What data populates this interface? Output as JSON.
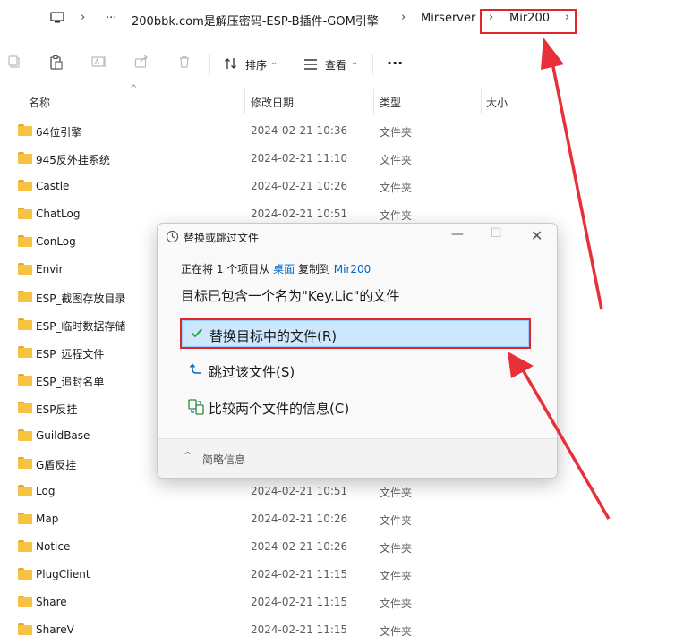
{
  "address": {
    "crumbs": [
      "200bbk.com是解压密码-ESP-B插件-GOM引擎",
      "Mirserver",
      "Mir200"
    ],
    "more": "···"
  },
  "toolbar": {
    "sort_label": "排序",
    "view_label": "查看",
    "more": "···"
  },
  "columns": {
    "name": "名称",
    "date": "修改日期",
    "type": "类型",
    "size": "大小"
  },
  "files": [
    {
      "name": "64位引擎",
      "date": "2024-02-21 10:36",
      "type": "文件夹"
    },
    {
      "name": "945反外挂系统",
      "date": "2024-02-21 11:10",
      "type": "文件夹"
    },
    {
      "name": "Castle",
      "date": "2024-02-21 10:26",
      "type": "文件夹"
    },
    {
      "name": "ChatLog",
      "date": "2024-02-21 10:51",
      "type": "文件夹"
    },
    {
      "name": "ConLog",
      "date": "",
      "type": ""
    },
    {
      "name": "Envir",
      "date": "",
      "type": ""
    },
    {
      "name": "ESP_截图存放目录",
      "date": "",
      "type": ""
    },
    {
      "name": "ESP_临时数据存储",
      "date": "",
      "type": ""
    },
    {
      "name": "ESP_远程文件",
      "date": "",
      "type": ""
    },
    {
      "name": "ESP_追封名单",
      "date": "",
      "type": ""
    },
    {
      "name": "ESP反挂",
      "date": "",
      "type": ""
    },
    {
      "name": "GuildBase",
      "date": "",
      "type": ""
    },
    {
      "name": "G盾反挂",
      "date": "",
      "type": ""
    },
    {
      "name": "Log",
      "date": "2024-02-21 10:51",
      "type": "文件夹"
    },
    {
      "name": "Map",
      "date": "2024-02-21 10:26",
      "type": "文件夹"
    },
    {
      "name": "Notice",
      "date": "2024-02-21 10:26",
      "type": "文件夹"
    },
    {
      "name": "PlugClient",
      "date": "2024-02-21 11:15",
      "type": "文件夹"
    },
    {
      "name": "Share",
      "date": "2024-02-21 11:15",
      "type": "文件夹"
    },
    {
      "name": "ShareV",
      "date": "2024-02-21 11:15",
      "type": "文件夹"
    }
  ],
  "dialog": {
    "title": "替换或跳过文件",
    "copy_prefix": "正在将 1 个项目从",
    "copy_source": "桌面",
    "copy_mid": "复制到",
    "copy_target": "Mir200",
    "heading": "目标已包含一个名为\"Key.Lic\"的文件",
    "option_replace": "替换目标中的文件(R)",
    "option_skip": "跳过该文件(S)",
    "option_compare": "比较两个文件的信息(C)",
    "details": "简略信息"
  },
  "colors": {
    "accent": "#0067c0",
    "highlight": "#e0262d",
    "folder": "#f5c242",
    "selected": "#cce8ff"
  }
}
